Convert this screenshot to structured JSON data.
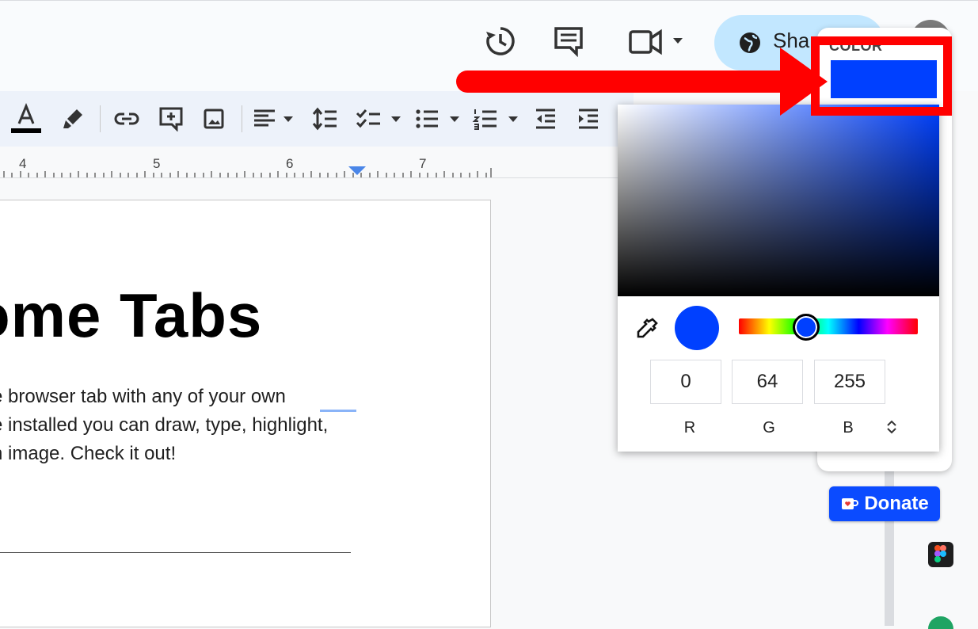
{
  "header": {
    "share_label": "Shar",
    "icons": [
      "history-icon",
      "comment-icon",
      "video-icon",
      "globe-icon",
      "avatar"
    ]
  },
  "toolbar": {
    "icons": [
      "text-color-icon",
      "highlighter-icon",
      "link-icon",
      "add-comment-icon",
      "image-icon",
      "align-icon",
      "line-spacing-icon",
      "checklist-icon",
      "bullet-list-icon",
      "numbered-list-icon",
      "indent-decrease-icon",
      "indent-increase-icon"
    ]
  },
  "ruler": {
    "marks": [
      "4",
      "5",
      "6",
      "7"
    ]
  },
  "document": {
    "title": "ome Tabs",
    "paragraph_lines": [
      "e browser tab with any of your own",
      "e installed you can draw, type, highlight,",
      "n image. Check it out!"
    ]
  },
  "color_panel": {
    "label": "COLOR",
    "current_color": "#0040ff"
  },
  "color_picker": {
    "r_value": "0",
    "g_value": "64",
    "b_value": "255",
    "r_label": "R",
    "g_label": "G",
    "b_label": "B",
    "mode_toggle_icon": "updown-icon"
  },
  "sidebar": {
    "donate_label": "Donate"
  },
  "colors": {
    "accent_red": "#ff0000",
    "selected_blue": "#0040ff",
    "share_bg": "#c2e7ff"
  }
}
